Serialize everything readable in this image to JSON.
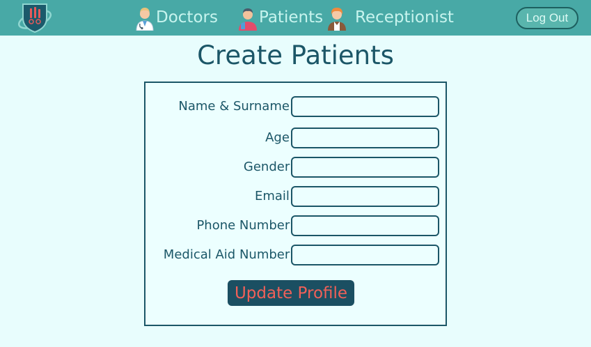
{
  "navbar": {
    "items": [
      {
        "label": "Doctors",
        "icon": "doctor-avatar-icon"
      },
      {
        "label": "Patients",
        "icon": "patient-avatar-icon"
      },
      {
        "label": "Receptionist",
        "icon": "receptionist-avatar-icon"
      }
    ],
    "logout_label": "Log Out",
    "logo_icon": "hospital-shield-logo-icon"
  },
  "page": {
    "title": "Create Patients"
  },
  "form": {
    "fields": [
      {
        "label": "Name & Surname:",
        "value": ""
      },
      {
        "label": "Age:",
        "value": ""
      },
      {
        "label": "Gender:",
        "value": ""
      },
      {
        "label": "Email:",
        "value": ""
      },
      {
        "label": "Phone Number:",
        "value": ""
      },
      {
        "label": "Medical Aid Number:",
        "value": ""
      }
    ],
    "submit_label": "Update Profile"
  },
  "colors": {
    "navbar": "#48a9a6",
    "background": "#e8fdfd",
    "primary_text": "#1b5667",
    "button_bg": "#1b4f62",
    "button_text": "#f06058"
  }
}
